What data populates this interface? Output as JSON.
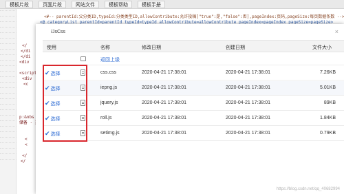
{
  "toolbar": {
    "buttons": [
      {
        "label": "模板片段"
      },
      {
        "label": "页面片段"
      },
      {
        "label": "网站文件"
      },
      {
        "label": "模板帮助"
      },
      {
        "label": "模板手册"
      }
    ]
  },
  "editor": {
    "comment_line": "<#-- parentId:父分类ID,typeId:分类类型ID,allowContribute:允许投稿[\"true\":是,\"false\":否],pageIndex:页码,pageSize:每页数据条数 -->",
    "tag_line": "<@_categoryList parentId=parentId typeId=typeId allowContribute=allowContribute pageIndex=pageIndex pageSize=pageSize>",
    "fragments": [
      "</",
      "</di",
      "</di",
      "<div",
      "<script",
      "<div",
      "<c",
      "p:&nbs",
      "储备 - 天",
      "<",
      "<",
      "</",
      "</"
    ]
  },
  "dialog": {
    "title": "/JsCss",
    "close_symbol": "×",
    "columns": {
      "use": "使用",
      "name": "名称",
      "modified": "修改日期",
      "created": "创建日期",
      "size": "文件大小"
    },
    "up_label": "返回上级",
    "select_label": "选择",
    "files": [
      {
        "name": "css.css",
        "modified": "2020-04-21 17:38:01",
        "created": "2020-04-21 17:38:01",
        "size": "7.26KB"
      },
      {
        "name": "iepng.js",
        "modified": "2020-04-21 17:38:01",
        "created": "2020-04-21 17:38:01",
        "size": "5.01KB"
      },
      {
        "name": "jquery.js",
        "modified": "2020-04-21 17:38:01",
        "created": "2020-04-21 17:38:01",
        "size": "89KB"
      },
      {
        "name": "roll.js",
        "modified": "2020-04-21 17:38:01",
        "created": "2020-04-21 17:38:01",
        "size": "1.84KB"
      },
      {
        "name": "setimg.js",
        "modified": "2020-04-21 17:38:01",
        "created": "2020-04-21 17:38:01",
        "size": "0.79KB"
      }
    ]
  },
  "watermark": "https://blog.csdn.net/qq_40682994",
  "colors": {
    "link": "#2d6bd3",
    "highlight_border": "#d9262c",
    "header_bg": "#f3f3f3",
    "alt_row_bg": "#f5f7fb"
  },
  "icons": {
    "check": "check-icon",
    "file": "file-icon",
    "folder": "folder-icon",
    "close": "close-icon"
  }
}
